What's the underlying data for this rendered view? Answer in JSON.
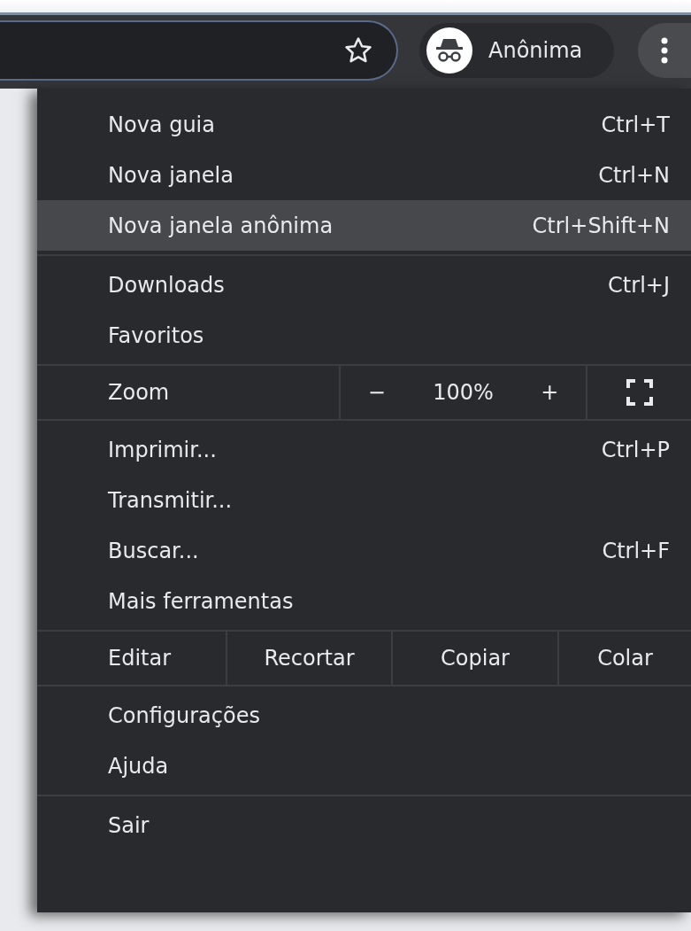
{
  "toolbar": {
    "profile_label": "Anônima"
  },
  "menu": {
    "sections": [
      {
        "items": [
          {
            "kind": "item",
            "label": "Nova guia",
            "shortcut": "Ctrl+T",
            "selected": false
          },
          {
            "kind": "item",
            "label": "Nova janela",
            "shortcut": "Ctrl+N",
            "selected": false
          },
          {
            "kind": "item",
            "label": "Nova janela anônima",
            "shortcut": "Ctrl+Shift+N",
            "selected": true
          }
        ]
      },
      {
        "items": [
          {
            "kind": "item",
            "label": "Downloads",
            "shortcut": "Ctrl+J",
            "selected": false
          },
          {
            "kind": "item",
            "label": "Favoritos",
            "selected": false
          }
        ]
      },
      {
        "items": [
          {
            "kind": "zoom",
            "label": "Zoom",
            "minus": "−",
            "value": "100%",
            "plus": "+"
          }
        ]
      },
      {
        "items": [
          {
            "kind": "item",
            "label": "Imprimir...",
            "shortcut": "Ctrl+P",
            "selected": false
          },
          {
            "kind": "item",
            "label": "Transmitir...",
            "selected": false
          },
          {
            "kind": "item",
            "label": "Buscar...",
            "shortcut": "Ctrl+F",
            "selected": false
          },
          {
            "kind": "item",
            "label": "Mais ferramentas",
            "selected": false
          }
        ]
      },
      {
        "items": [
          {
            "kind": "edit",
            "label": "Editar",
            "actions": [
              "Recortar",
              "Copiar",
              "Colar"
            ]
          }
        ]
      },
      {
        "items": [
          {
            "kind": "item",
            "label": "Configurações",
            "selected": false
          },
          {
            "kind": "item",
            "label": "Ajuda",
            "selected": false
          }
        ]
      },
      {
        "items": [
          {
            "kind": "item",
            "label": "Sair",
            "selected": false
          }
        ]
      }
    ]
  }
}
